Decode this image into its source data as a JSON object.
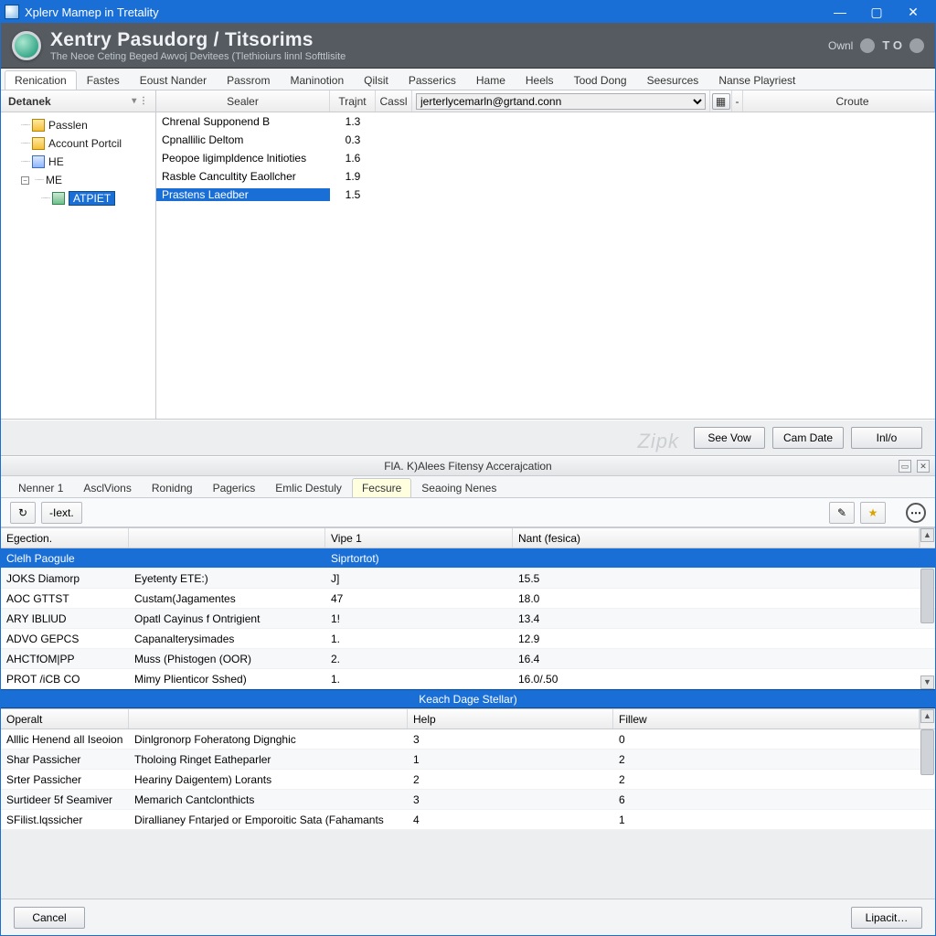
{
  "titlebar": {
    "text": "Xplerv Mamep in Tretality"
  },
  "banner": {
    "title": "Xentry Pasudorg / Titsorims",
    "subtitle": "The Neoe Ceting Beged Awvoj Devitees (Tlethioiurs linnl Softtlisite",
    "right_label": "Ownl",
    "right_code": "T O"
  },
  "main_tabs": [
    "Renication",
    "Fastes",
    "Eoust Nander",
    "Passrom",
    "Maninotion",
    "Qilsit",
    "Passerics",
    "Hame",
    "Heels",
    "Tood Dong",
    "Seesurces",
    "Nanse Playriest"
  ],
  "main_tabs_active": 0,
  "sidebar": {
    "header": "Detanek",
    "nodes": [
      {
        "label": "Passlen",
        "icon": "folder",
        "depth": 1
      },
      {
        "label": "Account Portcil",
        "icon": "folder",
        "depth": 1
      },
      {
        "label": "HE",
        "icon": "sheet",
        "depth": 1
      },
      {
        "label": "ME",
        "icon": "none",
        "depth": 1,
        "expandable": true
      },
      {
        "label": "ATPIET",
        "icon": "cube",
        "depth": 2,
        "selected": true
      }
    ]
  },
  "list_columns": {
    "sealer": "Sealer",
    "trajnt": "Trajnt",
    "cassl": "Cassl",
    "croute": "Croute"
  },
  "list_combo_value": "jerterlycemarln@grtand.conn",
  "list_rows": [
    {
      "name": "Chrenal Supponend B",
      "val": "1.3"
    },
    {
      "name": "Cpnallilic Deltom",
      "val": "0.3"
    },
    {
      "name": "Peopoe ligimpldence lnitioties",
      "val": "1.6"
    },
    {
      "name": "Rasble Cancultity Eaollcher",
      "val": "1.9"
    },
    {
      "name": "Prastens Laedber",
      "val": "1.5",
      "selected": true
    }
  ],
  "mid_buttons": {
    "see_vow": "See Vow",
    "cam_date": "Cam Date",
    "info": "Inl/o"
  },
  "mid_ghost": "Zipk",
  "subpanel_title": "FlA. K)Alees Fitensy Accerajcation",
  "sub_tabs": [
    "Nenner 1",
    "AsclVions",
    "Ronidng",
    "Pagerics",
    "Emlic Destuly",
    "Fecsure",
    "Seaoing Nenes"
  ],
  "sub_tabs_active": 5,
  "toolbar2": {
    "text_btn": "-Iext."
  },
  "grid1": {
    "cols": [
      "Egection.",
      "",
      "Vipe 1",
      "Nant (fesica)"
    ],
    "header_row": {
      "c1": "Clelh Paogule",
      "c3": "Siprtortot)"
    },
    "rows": [
      {
        "c1": "JOKS Diamorp",
        "c2": "Eyetenty ETE:)",
        "c3": "J]",
        "c4": "15.5"
      },
      {
        "c1": "AOC GTTST",
        "c2": "Custam(Jagamentes",
        "c3": "47",
        "c4": "18.0"
      },
      {
        "c1": "ARY IBLlUD",
        "c2": "Opatl Cayinus f Ontrigient",
        "c3": "1!",
        "c4": "13.4"
      },
      {
        "c1": "ADVO GEPCS",
        "c2": "Capanalterysimades",
        "c3": "1.",
        "c4": "12.9"
      },
      {
        "c1": "AHCTfOM|PP",
        "c2": "Muss (Phistogen (OOR)",
        "c3": "2.",
        "c4": "16.4"
      },
      {
        "c1": "PROT /iCB CO",
        "c2": "Mimy Plienticor Sshed)",
        "c3": "1.",
        "c4": "16.0/.50"
      }
    ]
  },
  "divider_label": "Keach Dage Stellar)",
  "grid2": {
    "cols": [
      "Operalt",
      "",
      "Help",
      "Fillew"
    ],
    "rows": [
      {
        "c1": "Alllic Henend all Iseoion",
        "c2": "Dinlgronorp Foheratong Dignghic",
        "c3": "3",
        "c4": "0"
      },
      {
        "c1": "Shar Passicher",
        "c2": "Tholoing Ringet Eatheparler",
        "c3": "1",
        "c4": "2"
      },
      {
        "c1": "Srter Passicher",
        "c2": "Heariny Daigentem) Lorants",
        "c3": "2",
        "c4": "2"
      },
      {
        "c1": "Surtideer 5f Seamiver",
        "c2": "Memarich Cantclonthicts",
        "c3": "3",
        "c4": "6"
      },
      {
        "c1": "SFilist.lqssicher",
        "c2": "Dirallianey Fntarjed or Emporoitic Sata (Fahamants",
        "c3": "4",
        "c4": "1"
      }
    ]
  },
  "footer": {
    "cancel": "Cancel",
    "lipacit": "Lipacit…"
  }
}
